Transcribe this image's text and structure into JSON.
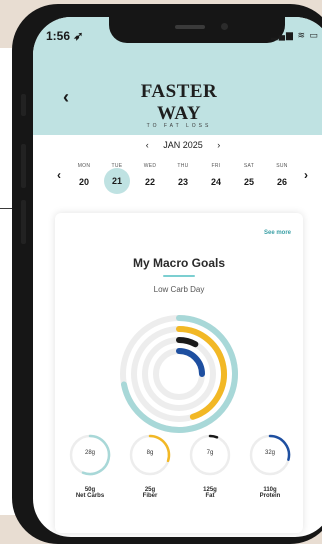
{
  "status_bar": {
    "time": "1:56 ➶",
    "icons": "▂▄▆ ≋ ▭"
  },
  "header": {
    "back": "‹",
    "logo_main": "FASTER WAY",
    "logo_sub": "TO FAT LOSS"
  },
  "calendar": {
    "prev_month": "‹",
    "month": "JAN 2025",
    "next_month": "›",
    "prev_week": "‹",
    "next_week": "›",
    "days": [
      {
        "dow": "MON",
        "num": "20"
      },
      {
        "dow": "TUE",
        "num": "21"
      },
      {
        "dow": "WED",
        "num": "22"
      },
      {
        "dow": "THU",
        "num": "23"
      },
      {
        "dow": "FRI",
        "num": "24"
      },
      {
        "dow": "SAT",
        "num": "25"
      },
      {
        "dow": "SUN",
        "num": "26"
      }
    ],
    "selected_day": "21"
  },
  "card": {
    "see_more": "See more",
    "title": "My Macro Goals",
    "subtitle": "Low Carb Day",
    "rings": [
      {
        "color": "#a8d8d8",
        "progress": 0.72
      },
      {
        "color": "#f2b825",
        "progress": 0.45
      },
      {
        "color": "#1a1a1a",
        "progress": 0.08
      },
      {
        "color": "#1e4fa0",
        "progress": 0.25
      }
    ],
    "macros": [
      {
        "value": "28g",
        "amount": "50g",
        "name": "Net Carbs",
        "color": "#a8d8d8",
        "progress": 0.56
      },
      {
        "value": "8g",
        "amount": "25g",
        "name": "Fiber",
        "color": "#f2b825",
        "progress": 0.3
      },
      {
        "value": "7g",
        "amount": "125g",
        "name": "Fat",
        "color": "#1a1a1a",
        "progress": 0.06
      },
      {
        "value": "32g",
        "amount": "110g",
        "name": "Protein",
        "color": "#1e4fa0",
        "progress": 0.29
      }
    ]
  }
}
